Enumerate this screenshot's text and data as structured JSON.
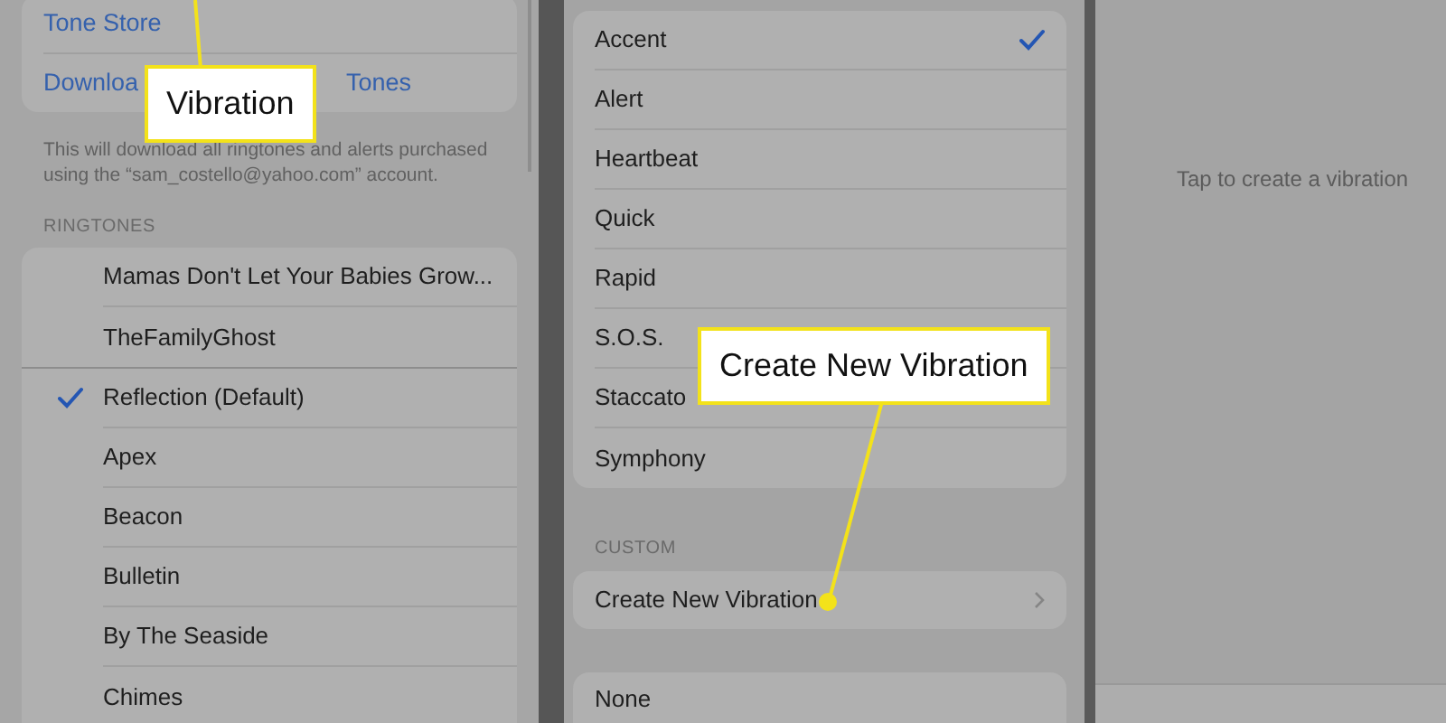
{
  "left_panel": {
    "store_links": [
      {
        "label": "Tone Store"
      }
    ],
    "download_row": {
      "visible_start": "Downloa",
      "visible_end": "Tones"
    },
    "footnote": "This will download all ringtones and alerts purchased using the “sam_costello@yahoo.com” account.",
    "ringtones": {
      "header": "RINGTONES",
      "groups": [
        {
          "items": [
            {
              "label": "Mamas Don't Let Your Babies Grow...",
              "selected": false
            },
            {
              "label": "TheFamilyGhost",
              "selected": false
            }
          ]
        },
        {
          "items": [
            {
              "label": "Reflection (Default)",
              "selected": true
            },
            {
              "label": "Apex",
              "selected": false
            },
            {
              "label": "Beacon",
              "selected": false
            },
            {
              "label": "Bulletin",
              "selected": false
            },
            {
              "label": "By The Seaside",
              "selected": false
            },
            {
              "label": "Chimes",
              "selected": false
            }
          ]
        }
      ]
    }
  },
  "middle_panel": {
    "standard": [
      {
        "label": "Accent",
        "selected": true
      },
      {
        "label": "Alert",
        "selected": false
      },
      {
        "label": "Heartbeat",
        "selected": false
      },
      {
        "label": "Quick",
        "selected": false
      },
      {
        "label": "Rapid",
        "selected": false
      },
      {
        "label": "S.O.S.",
        "selected": false
      },
      {
        "label": "Staccato",
        "selected": false
      },
      {
        "label": "Symphony",
        "selected": false
      }
    ],
    "custom": {
      "header": "CUSTOM",
      "item": "Create New Vibration"
    },
    "none_item": "None"
  },
  "right_panel": {
    "hint": "Tap to create a vibration"
  },
  "callouts": [
    {
      "text": "Vibration"
    },
    {
      "text": "Create New Vibration"
    }
  ]
}
